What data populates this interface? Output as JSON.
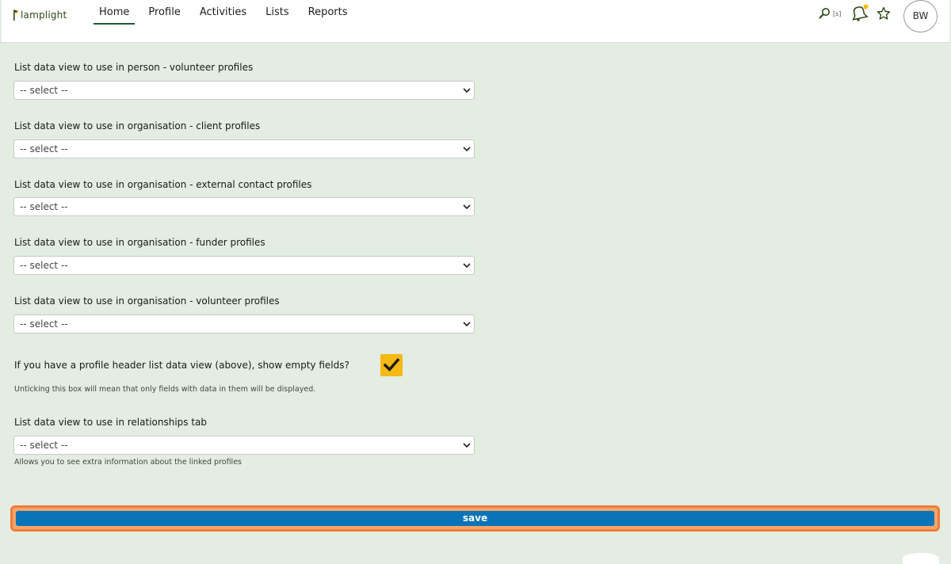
{
  "header": {
    "logo_text": "lamplight",
    "nav": [
      {
        "label": "Home",
        "active": true
      },
      {
        "label": "Profile",
        "active": false
      },
      {
        "label": "Activities",
        "active": false
      },
      {
        "label": "Lists",
        "active": false
      },
      {
        "label": "Reports",
        "active": false
      }
    ],
    "search_shortcut": "[s]",
    "avatar_initials": "BW",
    "icons": [
      "search-icon",
      "bell-icon",
      "star-icon"
    ],
    "notification_dot_color": "#f6b913"
  },
  "form": {
    "fields": [
      {
        "label": "List data view to use in person - volunteer profiles",
        "value": "-- select --"
      },
      {
        "label": "List data view to use in organisation - client profiles",
        "value": "-- select --"
      },
      {
        "label": "List data view to use in organisation - external contact profiles",
        "value": "-- select --"
      },
      {
        "label": "List data view to use in organisation - funder profiles",
        "value": "-- select --"
      },
      {
        "label": "List data view to use in organisation - volunteer profiles",
        "value": "-- select --"
      }
    ],
    "empty_fields": {
      "label": "If you have a profile header list data view (above), show empty fields?",
      "checked": true,
      "hint": "Unticking this box will mean that only fields with data in them will be displayed."
    },
    "relationships": {
      "label": "List data view to use in relationships tab",
      "value": "-- select --",
      "hint": "Allows you to see extra information about the linked profiles"
    },
    "save_label": "save"
  },
  "colors": {
    "background": "#e3ede2",
    "accent_green": "#1f5b2e",
    "checkbox": "#f6b913",
    "save_button": "#0a74b8",
    "save_focus_ring": "#f07c3c"
  }
}
